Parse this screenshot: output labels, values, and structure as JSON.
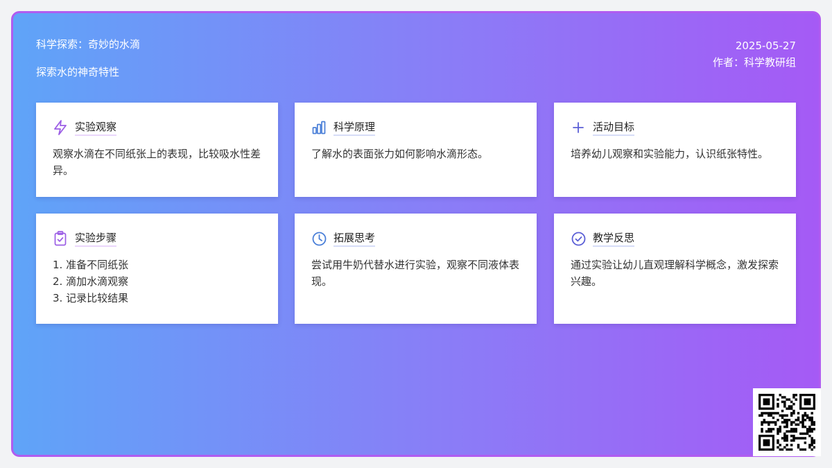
{
  "header": {
    "title": "科学探索：奇妙的水滴",
    "subtitle": "探索水的神奇特性",
    "date": "2025-05-27",
    "author": "作者：科学教研组"
  },
  "cards": [
    {
      "icon": "lightning-icon",
      "title": "实验观察",
      "body": "观察水滴在不同纸张上的表现，比较吸水性差异。"
    },
    {
      "icon": "bar-chart-icon",
      "title": "科学原理",
      "body": "了解水的表面张力如何影响水滴形态。"
    },
    {
      "icon": "plus-icon",
      "title": "活动目标",
      "body": "培养幼儿观察和实验能力，认识纸张特性。"
    },
    {
      "icon": "clipboard-check-icon",
      "title": "实验步骤",
      "steps": [
        "1. 准备不同纸张",
        "2. 滴加水滴观察",
        "3. 记录比较结果"
      ]
    },
    {
      "icon": "clock-icon",
      "title": "拓展思考",
      "body": "尝试用牛奶代替水进行实验，观察不同液体表现。"
    },
    {
      "icon": "check-circle-icon",
      "title": "教学反思",
      "body": "通过实验让幼儿直观理解科学概念，激发探索兴趣。"
    }
  ],
  "colors": {
    "gradient_start": "#5fa4f8",
    "gradient_end": "#a55af5",
    "border": "#b05cf0",
    "icon_purple": "#9b5de5",
    "icon_blue": "#4a7fd8",
    "icon_indigo": "#5b5fd6"
  },
  "qr_code": {
    "icon": "qr-code-icon"
  }
}
